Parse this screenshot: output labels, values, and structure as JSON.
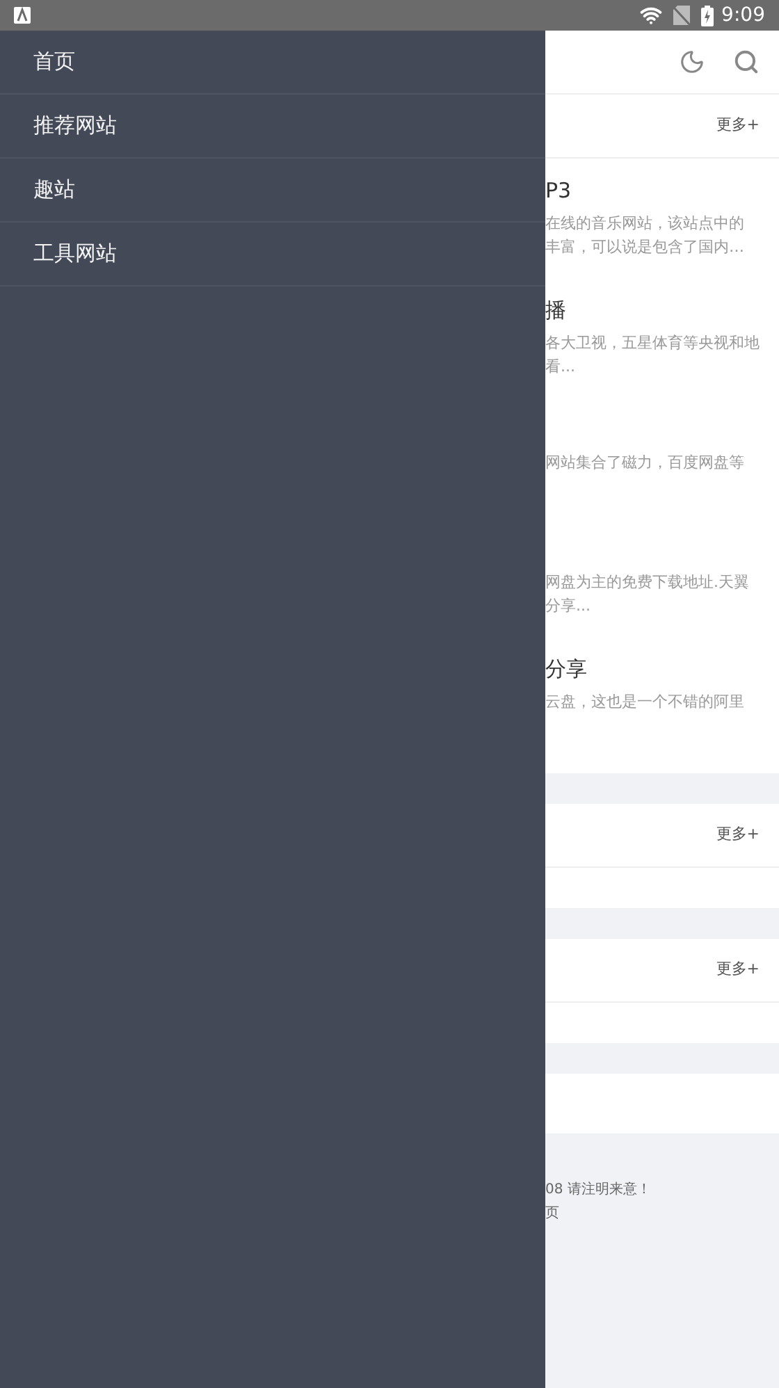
{
  "status_bar": {
    "time": "9:09"
  },
  "drawer": {
    "items": [
      {
        "label": "首页"
      },
      {
        "label": "推荐网站"
      },
      {
        "label": "趣站"
      },
      {
        "label": "工具网站"
      }
    ]
  },
  "sections": [
    {
      "more": "更多+",
      "entries": [
        {
          "title": "P3",
          "lines": [
            "在线的音乐网站，该站点中的",
            "丰富，可以说是包含了国内…"
          ]
        },
        {
          "title": "播",
          "lines": [
            "各大卫视，五星体育等央视和地",
            "看..."
          ]
        },
        {
          "lines": [
            "网站集合了磁力，百度网盘等"
          ]
        },
        {
          "lines": [
            "网盘为主的免费下载地址.天翼",
            "分享..."
          ]
        },
        {
          "title": "分享",
          "lines": [
            "云盘，这也是一个不错的阿里"
          ]
        }
      ]
    },
    {
      "more": "更多+"
    },
    {
      "more": "更多+"
    }
  ],
  "footer": {
    "lines": [
      "08 请注明来意！",
      "页"
    ]
  }
}
